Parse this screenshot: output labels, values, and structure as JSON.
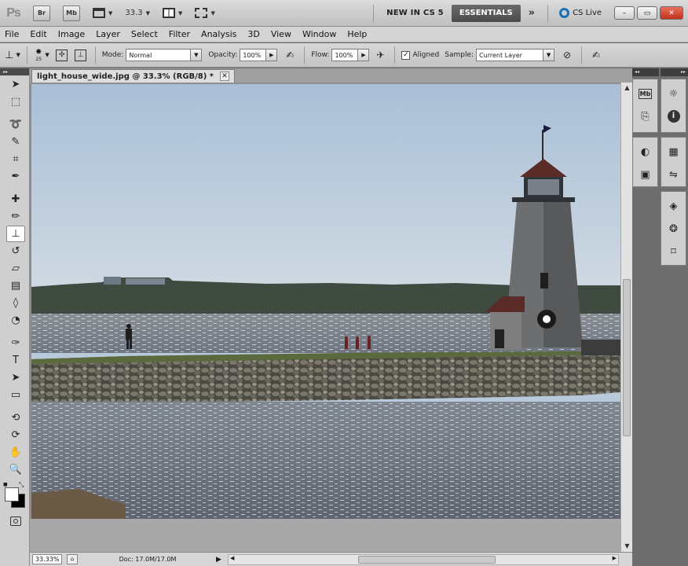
{
  "appbar": {
    "logo": "Ps",
    "bridge_btn": "Br",
    "minibridge_btn": "Mb",
    "zoom_value": "33.3",
    "workspace_new": "NEW IN CS 5",
    "workspace_active": "ESSENTIALS",
    "more": "»",
    "cslive": "CS Live",
    "min": "–",
    "restore": "▭",
    "close": "✕"
  },
  "menu": [
    "File",
    "Edit",
    "Image",
    "Layer",
    "Select",
    "Filter",
    "Analysis",
    "3D",
    "View",
    "Window",
    "Help"
  ],
  "options": {
    "brush_size": "25",
    "mode_label": "Mode:",
    "mode_value": "Normal",
    "opacity_label": "Opacity:",
    "opacity_value": "100%",
    "flow_label": "Flow:",
    "flow_value": "100%",
    "aligned_label": "Aligned",
    "aligned_checked": "✓",
    "sample_label": "Sample:",
    "sample_value": "Current Layer"
  },
  "document": {
    "tab_title": "light_house_wide.jpg @ 33.3% (RGB/8) *",
    "tab_close": "✕"
  },
  "status": {
    "zoom": "33.33%",
    "doc_info": "Doc: 17.0M/17.0M",
    "arrow": "▶"
  },
  "tools": [
    {
      "name": "move-tool-icon",
      "glyph": "➤"
    },
    {
      "name": "marquee-tool-icon",
      "glyph": "⬚"
    },
    {
      "name": "lasso-tool-icon",
      "glyph": "➰"
    },
    {
      "name": "quick-select-tool-icon",
      "glyph": "✎"
    },
    {
      "name": "crop-tool-icon",
      "glyph": "⌗"
    },
    {
      "name": "eyedropper-tool-icon",
      "glyph": "✒"
    },
    {
      "name": "spot-healing-tool-icon",
      "glyph": "✚"
    },
    {
      "name": "brush-tool-icon",
      "glyph": "✏"
    },
    {
      "name": "clone-stamp-tool-icon",
      "glyph": "⊥"
    },
    {
      "name": "history-brush-tool-icon",
      "glyph": "↺"
    },
    {
      "name": "eraser-tool-icon",
      "glyph": "▱"
    },
    {
      "name": "gradient-tool-icon",
      "glyph": "▤"
    },
    {
      "name": "blur-tool-icon",
      "glyph": "◊"
    },
    {
      "name": "dodge-tool-icon",
      "glyph": "◔"
    },
    {
      "name": "pen-tool-icon",
      "glyph": "✑"
    },
    {
      "name": "type-tool-icon",
      "glyph": "T"
    },
    {
      "name": "path-select-tool-icon",
      "glyph": "➤"
    },
    {
      "name": "shape-tool-icon",
      "glyph": "▭"
    },
    {
      "name": "3d-rotate-tool-icon",
      "glyph": "⟲"
    },
    {
      "name": "3d-orbit-tool-icon",
      "glyph": "⟳"
    },
    {
      "name": "hand-tool-icon",
      "glyph": "✋"
    },
    {
      "name": "zoom-tool-icon",
      "glyph": "🔍"
    }
  ],
  "colors": {
    "foreground": "#ffffff",
    "background": "#000000",
    "accent_active_workspace": "#555555",
    "cslive_ring": "#1a6fb3",
    "close_button": "#c3321c"
  }
}
